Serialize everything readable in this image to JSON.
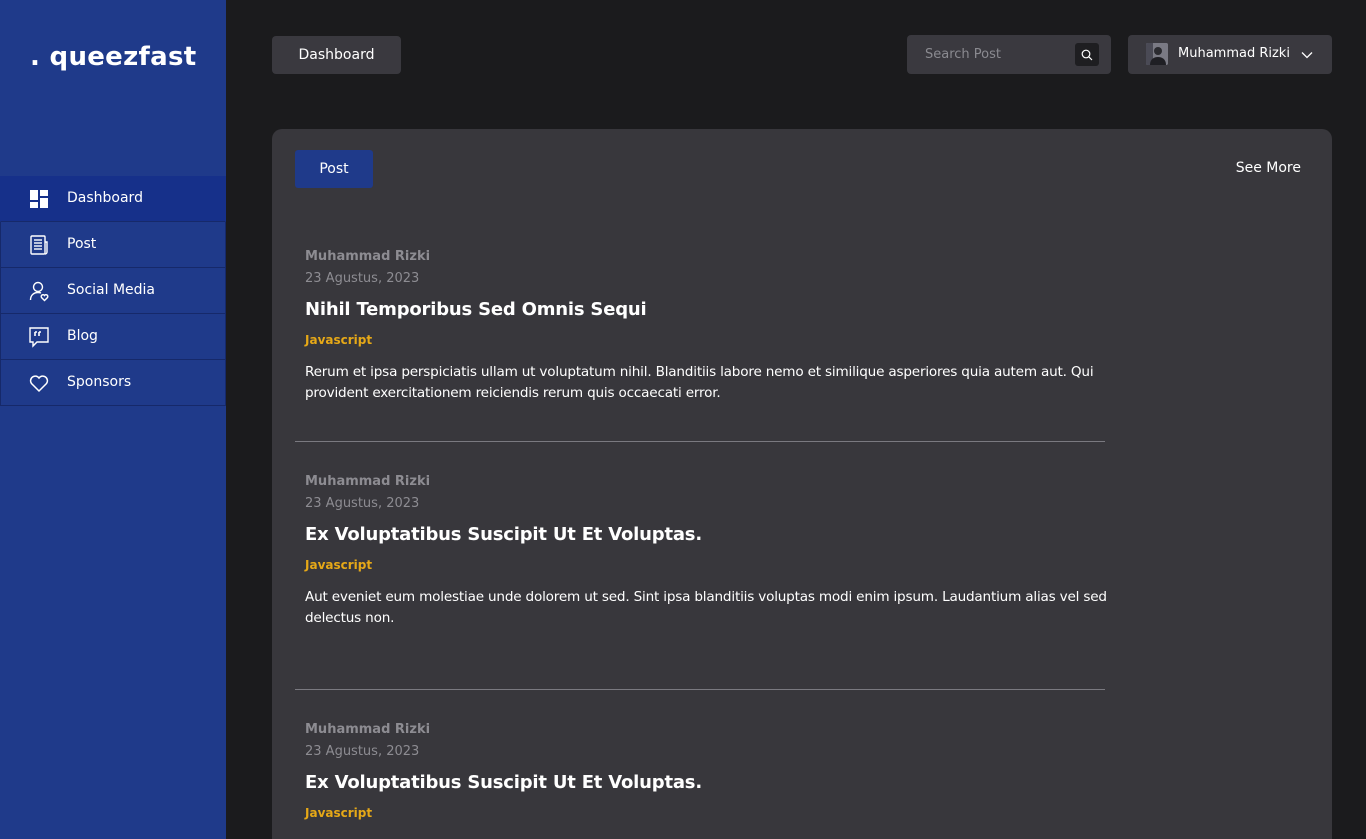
{
  "brand": {
    "name": ". queezfast"
  },
  "sidebar": {
    "items": [
      {
        "label": "Dashboard",
        "icon": "dashboard-icon",
        "active": true
      },
      {
        "label": "Post",
        "icon": "newspaper-icon",
        "active": false
      },
      {
        "label": "Social Media",
        "icon": "user-heart-icon",
        "active": false
      },
      {
        "label": "Blog",
        "icon": "quote-icon",
        "active": false
      },
      {
        "label": "Sponsors",
        "icon": "heart-icon",
        "active": false
      }
    ]
  },
  "header": {
    "breadcrumb": "Dashboard",
    "search_placeholder": "Search Post",
    "user_name": "Muhammad Rizki"
  },
  "main": {
    "tab_label": "Post",
    "see_more": "See More",
    "posts": [
      {
        "author": "Muhammad Rizki",
        "date": "23 Agustus, 2023",
        "title": "Nihil Temporibus Sed Omnis Sequi",
        "tag": "Javascript",
        "body": "Rerum et ipsa perspiciatis ullam ut voluptatum nihil. Blanditiis labore nemo et similique asperiores quia autem aut. Qui provident exercitationem reiciendis rerum quis occaecati error."
      },
      {
        "author": "Muhammad Rizki",
        "date": "23 Agustus, 2023",
        "title": "Ex Voluptatibus Suscipit Ut Et Voluptas.",
        "tag": "Javascript",
        "body": "Aut eveniet eum molestiae unde dolorem ut sed. Sint ipsa blanditiis voluptas modi enim ipsum. Laudantium alias vel sed delectus non."
      },
      {
        "author": "Muhammad Rizki",
        "date": "23 Agustus, 2023",
        "title": "Ex Voluptatibus Suscipit Ut Et Voluptas.",
        "tag": "Javascript",
        "body": ""
      }
    ]
  },
  "colors": {
    "sidebar_bg": "#1f3a8a",
    "accent": "#1f3a8a",
    "tag": "#e6a817",
    "panel_bg": "#38373c",
    "page_bg": "#1b1b1d"
  }
}
